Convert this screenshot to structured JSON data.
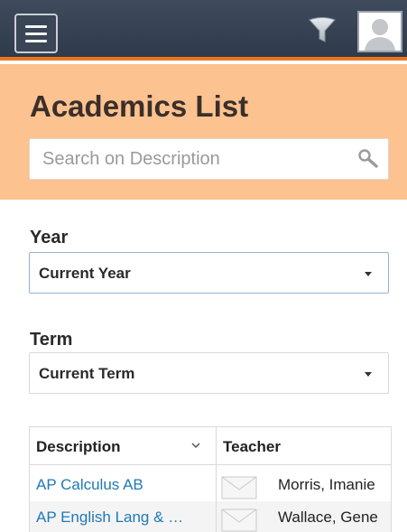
{
  "header": {
    "title": "Academics List",
    "search": {
      "placeholder": "Search on Description",
      "value": ""
    }
  },
  "filters": {
    "year": {
      "label": "Year",
      "selected": "Current Year"
    },
    "term": {
      "label": "Term",
      "selected": "Current Term"
    }
  },
  "table": {
    "columns": [
      "Description",
      "Teacher"
    ],
    "rows": [
      {
        "description": "AP Calculus AB",
        "teacher": "Morris, Imanie"
      },
      {
        "description": "AP English Lang & …",
        "teacher": "Wallace, Gene"
      }
    ]
  },
  "colors": {
    "topbar": "#34404f",
    "accent_line": "#e8761f",
    "header_bg": "#fcc28f",
    "link": "#1f79b8"
  },
  "icons": [
    "menu-icon",
    "filter-icon",
    "avatar-icon",
    "search-icon",
    "chevron-down-icon",
    "mail-icon"
  ]
}
